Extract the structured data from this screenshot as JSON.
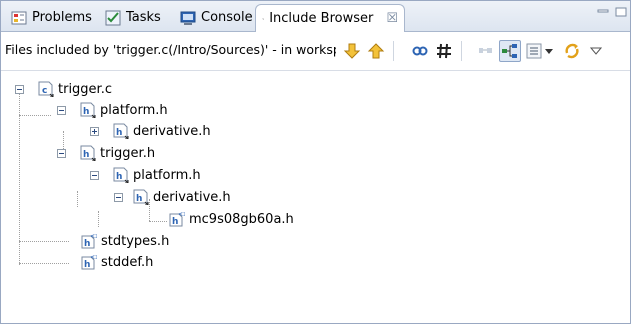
{
  "tabs": [
    {
      "label": "Problems",
      "icon": "problems-icon"
    },
    {
      "label": "Tasks",
      "icon": "tasks-icon"
    },
    {
      "label": "Console",
      "icon": "console-icon"
    },
    {
      "label": "Include Browser",
      "icon": "include-browser-icon",
      "active": true,
      "close": "☒"
    }
  ],
  "toolbar": {
    "label": "Files included by 'trigger.c(/Intro/Sources)' - in worksp",
    "buttons": [
      "arrow-down-icon",
      "arrow-up-icon",
      "link-icon",
      "hash-icon",
      "filter-icon",
      "hierarchy-icon",
      "list-icon",
      "dropdown-icon",
      "sync-icon",
      "view-menu-icon"
    ]
  },
  "tree": [
    {
      "label": "trigger.c",
      "type": "c-source",
      "toggle": "minus"
    },
    {
      "label": "platform.h",
      "type": "header",
      "toggle": "minus"
    },
    {
      "label": "derivative.h",
      "type": "header",
      "toggle": "plus"
    },
    {
      "label": "trigger.h",
      "type": "header",
      "toggle": "minus"
    },
    {
      "label": "platform.h",
      "type": "header",
      "toggle": "minus"
    },
    {
      "label": "derivative.h",
      "type": "header",
      "toggle": "minus"
    },
    {
      "label": "mc9s08gb60a.h",
      "type": "system-header",
      "toggle": "none"
    },
    {
      "label": "stdtypes.h",
      "type": "system-header",
      "toggle": "none"
    },
    {
      "label": "stddef.h",
      "type": "system-header",
      "toggle": "none"
    }
  ],
  "colors": {
    "accent": "#2d64b3",
    "arrow": "#e2a11a",
    "tabbar": "#dde5f0"
  }
}
